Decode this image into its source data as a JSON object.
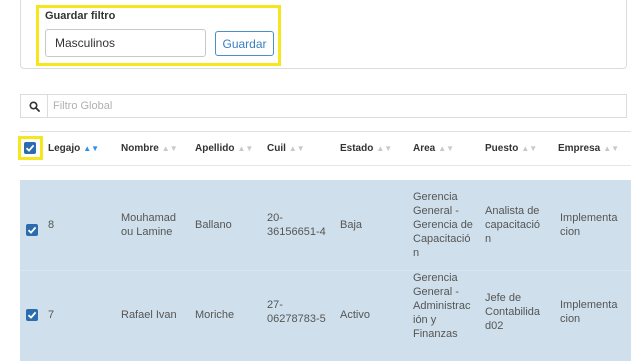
{
  "filter": {
    "title": "Guardar filtro",
    "input_value": "Masculinos",
    "save_label": "Guardar"
  },
  "search": {
    "placeholder": "Filtro Global"
  },
  "table": {
    "headers": [
      "Legajo",
      "Nombre",
      "Apellido",
      "Cuil",
      "Estado",
      "Area",
      "Puesto",
      "Empresa"
    ],
    "rows": [
      {
        "checked": true,
        "legajo": "8",
        "nombre": [
          "Mouhamad",
          "ou Lamine"
        ],
        "apellido": "Ballano",
        "cuil": [
          "20-",
          "36156651-4"
        ],
        "estado": "Baja",
        "area": [
          "Gerencia",
          "General -",
          "Gerencia de",
          "Capacitació",
          "n"
        ],
        "puesto": [
          "Analista de",
          "capacitació",
          "n"
        ],
        "empresa": [
          "Implementa",
          "cion"
        ]
      },
      {
        "checked": true,
        "legajo": "7",
        "nombre": [
          "Rafael Ivan"
        ],
        "apellido": "Moriche",
        "cuil": [
          "27-",
          "06278783-5"
        ],
        "estado": "Activo",
        "area": [
          "Gerencia",
          "General -",
          "Administrac",
          "ión y",
          "Finanzas"
        ],
        "puesto": [
          "Jefe de",
          "Contabilida",
          "d02"
        ],
        "empresa": [
          "Implementa",
          "cion"
        ]
      }
    ]
  },
  "colors": {
    "highlight": "#f5e61e",
    "accent": "#2b6cb0",
    "row_bg": "#cfe0ec"
  }
}
